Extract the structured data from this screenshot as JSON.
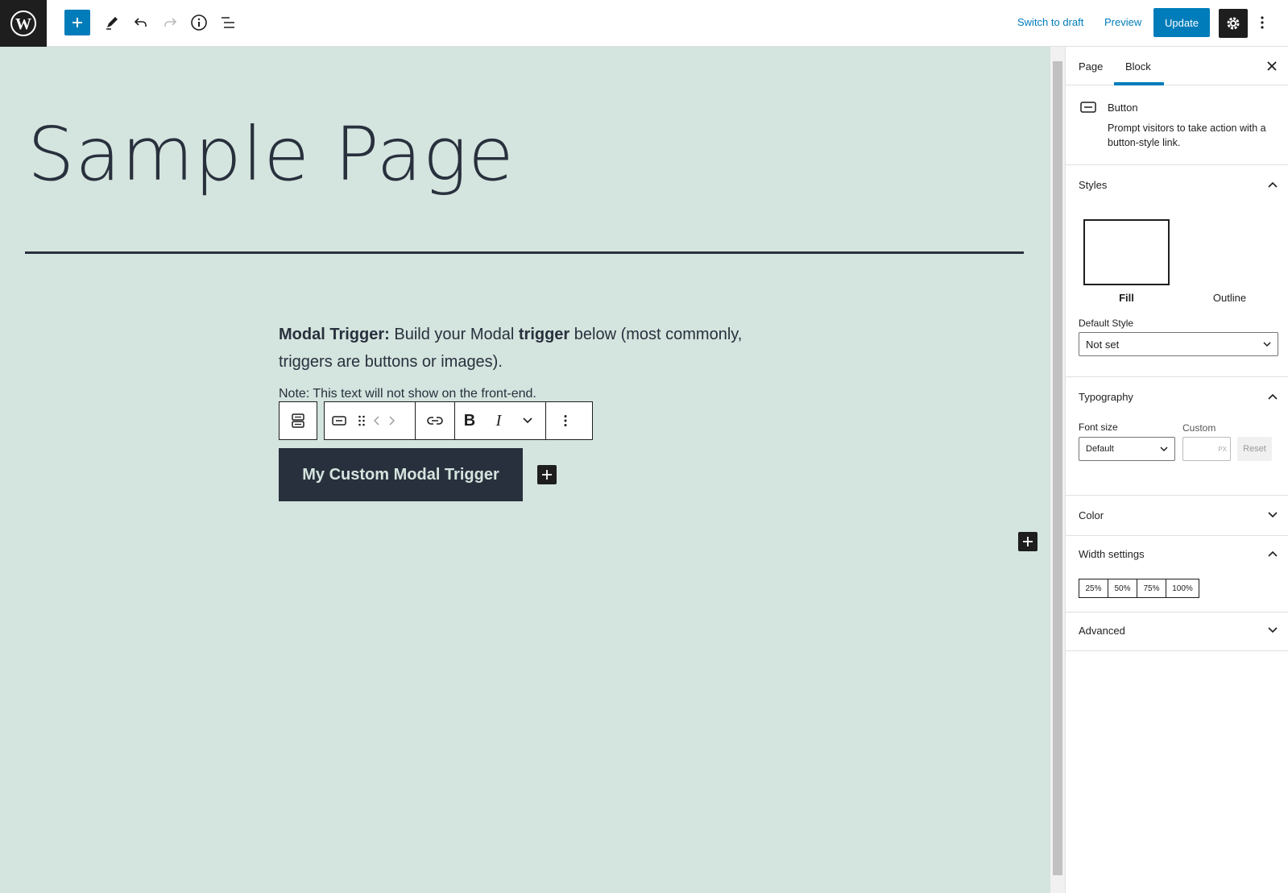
{
  "toolbar": {
    "switch_to_draft": "Switch to draft",
    "preview": "Preview",
    "update": "Update"
  },
  "content": {
    "title": "Sample Page",
    "para1_bold1": "Modal Trigger:",
    "para1_text1": " Build your Modal ",
    "para1_bold2": "trigger",
    "para1_text2": " below (most commonly,",
    "para1_line2": "triggers are buttons or images).",
    "note": "Note: This text will not show on the front-end.",
    "button_label": "My Custom Modal Trigger"
  },
  "sidebar": {
    "tabs": [
      "Page",
      "Block"
    ],
    "block_name": "Button",
    "block_desc": "Prompt visitors to take action with a button-style link.",
    "styles": {
      "header": "Styles",
      "options": [
        "Fill",
        "Outline"
      ],
      "default_style_label": "Default Style",
      "default_style_value": "Not set"
    },
    "typography": {
      "header": "Typography",
      "font_size_label": "Font size",
      "custom_label": "Custom",
      "font_size_value": "Default",
      "unit": "PX",
      "reset": "Reset"
    },
    "color": {
      "header": "Color"
    },
    "width": {
      "header": "Width settings",
      "options": [
        "25%",
        "50%",
        "75%",
        "100%"
      ]
    },
    "advanced": {
      "header": "Advanced"
    }
  },
  "colors": {
    "accent": "#007cba",
    "canvas_bg": "#d4e4de",
    "text_dark": "#28303d"
  }
}
